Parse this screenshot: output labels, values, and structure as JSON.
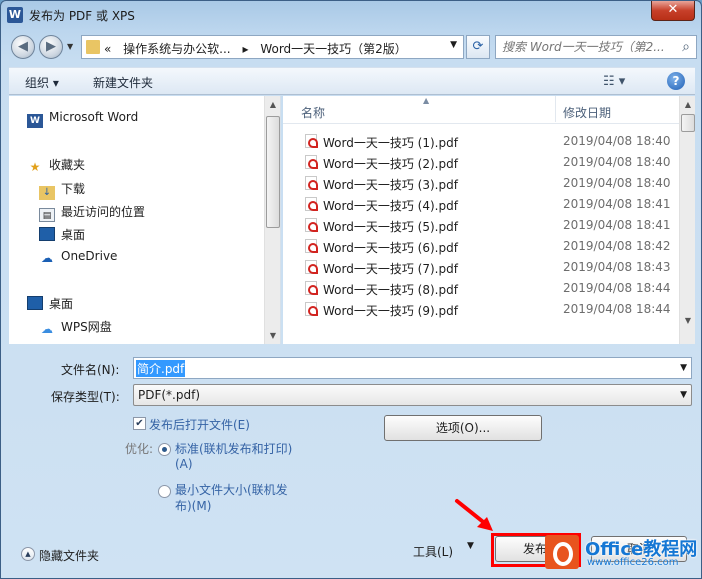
{
  "window": {
    "title": "发布为 PDF 或 XPS",
    "app_icon_letter": "W",
    "close_symbol": "✕"
  },
  "address_bar": {
    "prefix": "«",
    "segments": [
      "操作系统与办公软...",
      "Word一天一技巧（第2版）"
    ],
    "separator": "▸"
  },
  "search": {
    "placeholder": "搜索 Word一天一技巧（第2..."
  },
  "toolbar": {
    "organize": "组织 ▾",
    "new_folder": "新建文件夹",
    "help": "?"
  },
  "nav_pane": {
    "items": [
      {
        "label": "Microsoft Word",
        "icon": "word-icon"
      },
      {
        "label": "收藏夹",
        "icon": "star-icon"
      },
      {
        "label": "下载",
        "icon": "download-folder-icon"
      },
      {
        "label": "最近访问的位置",
        "icon": "recent-places-icon"
      },
      {
        "label": "桌面",
        "icon": "desktop-icon"
      },
      {
        "label": "OneDrive",
        "icon": "onedrive-icon"
      },
      {
        "label": "桌面",
        "icon": "desktop-icon"
      },
      {
        "label": "WPS网盘",
        "icon": "cloud-icon"
      }
    ]
  },
  "file_list": {
    "columns": {
      "name": "名称",
      "date": "修改日期"
    },
    "rows": [
      {
        "name": "Word一天一技巧 (1).pdf",
        "date": "2019/04/08 18:40"
      },
      {
        "name": "Word一天一技巧 (2).pdf",
        "date": "2019/04/08 18:40"
      },
      {
        "name": "Word一天一技巧 (3).pdf",
        "date": "2019/04/08 18:40"
      },
      {
        "name": "Word一天一技巧 (4).pdf",
        "date": "2019/04/08 18:41"
      },
      {
        "name": "Word一天一技巧 (5).pdf",
        "date": "2019/04/08 18:41"
      },
      {
        "name": "Word一天一技巧 (6).pdf",
        "date": "2019/04/08 18:42"
      },
      {
        "name": "Word一天一技巧 (7).pdf",
        "date": "2019/04/08 18:43"
      },
      {
        "name": "Word一天一技巧 (8).pdf",
        "date": "2019/04/08 18:44"
      },
      {
        "name": "Word一天一技巧 (9).pdf",
        "date": "2019/04/08 18:44"
      }
    ]
  },
  "form": {
    "filename_label": "文件名(N):",
    "filename_value": "简介.pdf",
    "type_label": "保存类型(T):",
    "type_value": "PDF(*.pdf)",
    "open_after_publish": "发布后打开文件(E)",
    "optimize_label": "优化:",
    "option_standard_line1": "标准(联机发布和打印)",
    "option_standard_line2": "(A)",
    "option_min_line1": "最小文件大小(联机发",
    "option_min_line2": "布)(M)",
    "options_button": "选项(O)...",
    "hide_folders": "隐藏文件夹",
    "tools": "工具(L)",
    "publish": "发布",
    "cancel": "取消"
  },
  "watermark": {
    "text": "Office教程网",
    "sub": "www.office26.com"
  },
  "colors": {
    "highlight": "#ff0000",
    "selection": "#3399ff",
    "pdf_red": "#d2231f"
  }
}
